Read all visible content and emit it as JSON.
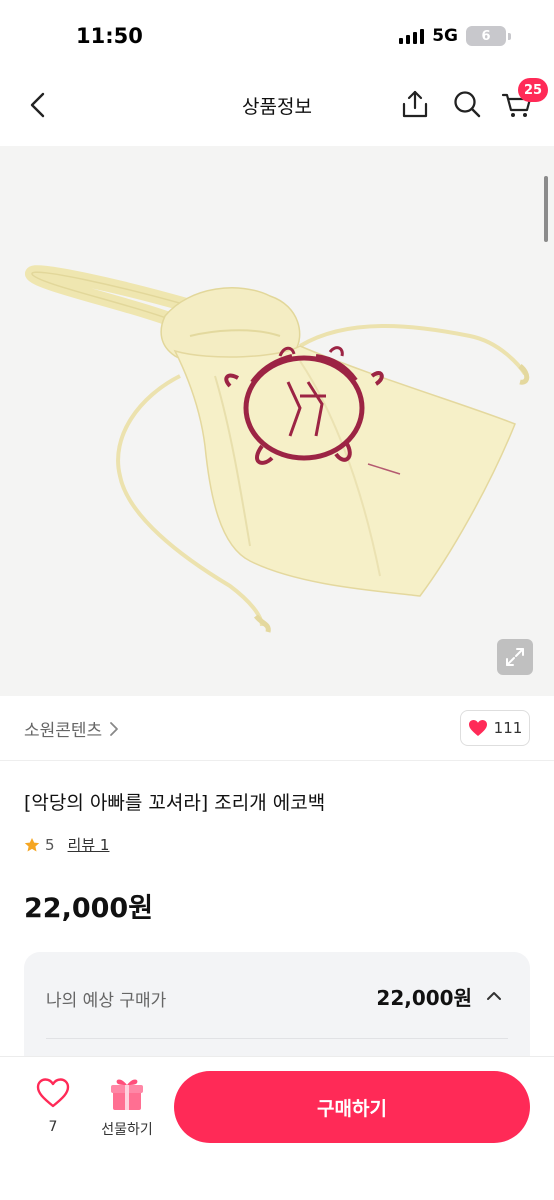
{
  "status_bar": {
    "time": "11:50",
    "network": "5G",
    "battery": "6"
  },
  "header": {
    "title": "상품정보",
    "cart_badge": "25"
  },
  "seller": {
    "name": "소원콘텐츠",
    "likes": "111"
  },
  "product": {
    "title": "[악당의 아빠를 꼬셔라] 조리개 에코백",
    "rating": "5",
    "review_label": "리뷰 1",
    "price": "22,000원"
  },
  "estimate": {
    "label": "나의 예상 구매가",
    "price": "22,000원"
  },
  "bottom_bar": {
    "wish_count": "7",
    "gift_label": "선물하기",
    "buy_label": "구매하기"
  },
  "colors": {
    "accent": "#ff2a57",
    "bag": "#f5efc4",
    "print": "#9c2444"
  }
}
